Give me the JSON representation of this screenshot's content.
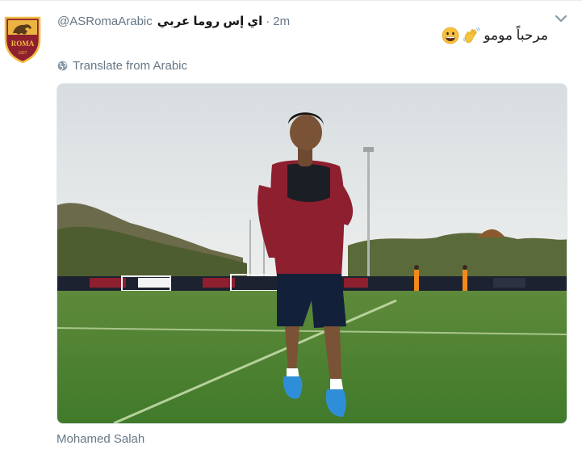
{
  "tweet": {
    "handle": "@ASRomaArabic",
    "display_name": "اي إس روما عربي",
    "separator": "·",
    "time": "2m",
    "text": "مرحباً مومو",
    "emojis": [
      "waving-hand",
      "grinning-face"
    ],
    "translate_label": "Translate from Arabic",
    "caption": "Mohamed Salah",
    "avatar_label": "ROMA",
    "avatar_year": "1927"
  },
  "colors": {
    "secondary_text": "#657786",
    "primary_text": "#14171a",
    "border": "#e1e8ed",
    "roma_red": "#8e1f2f",
    "roma_gold": "#f0bc42"
  }
}
